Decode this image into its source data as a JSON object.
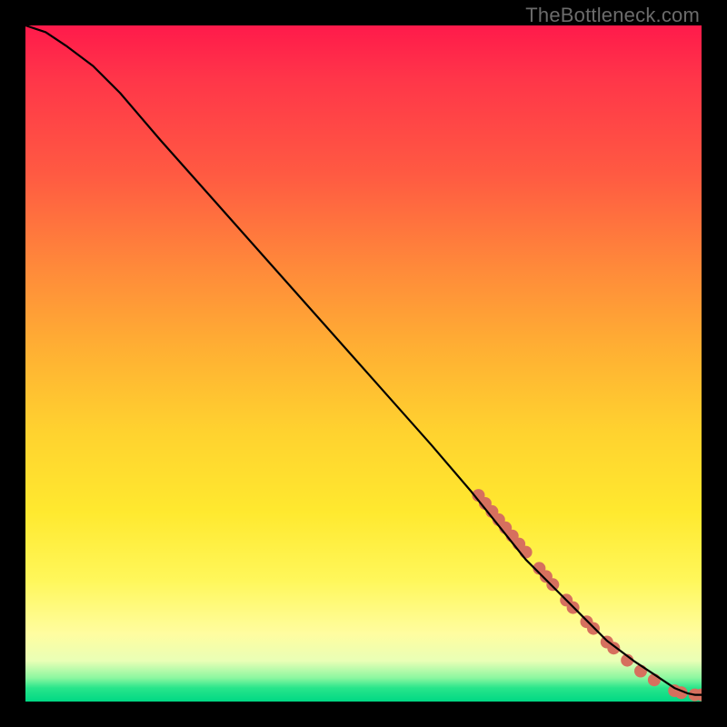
{
  "watermark": {
    "text": "TheBottleneck.com"
  },
  "chart_data": {
    "type": "line",
    "title": "",
    "xlabel": "",
    "ylabel": "",
    "xlim": [
      0,
      100
    ],
    "ylim": [
      0,
      100
    ],
    "grid": false,
    "legend": false,
    "background_gradient": "red-yellow-green-vertical",
    "series": [
      {
        "name": "curve",
        "color": "#000000",
        "x": [
          0,
          3,
          6,
          10,
          14,
          20,
          28,
          36,
          44,
          52,
          60,
          66,
          70,
          74,
          78,
          82,
          86,
          90,
          93,
          96,
          98,
          99,
          100
        ],
        "y": [
          100,
          99,
          97,
          94,
          90,
          83,
          74,
          65,
          56,
          47,
          38,
          31,
          26,
          21,
          17,
          13,
          9,
          6,
          4,
          2,
          1.2,
          1,
          1
        ]
      }
    ],
    "markers": {
      "name": "highlight-segments",
      "color": "#d6705e",
      "radius_px": 7,
      "points_xy": [
        [
          67,
          30.5
        ],
        [
          68,
          29.3
        ],
        [
          69,
          28.1
        ],
        [
          70,
          26.9
        ],
        [
          71,
          25.7
        ],
        [
          72,
          24.5
        ],
        [
          73,
          23.3
        ],
        [
          74,
          22.1
        ],
        [
          76,
          19.7
        ],
        [
          77,
          18.5
        ],
        [
          78,
          17.3
        ],
        [
          80,
          15.0
        ],
        [
          81,
          13.9
        ],
        [
          83,
          11.8
        ],
        [
          84,
          10.8
        ],
        [
          86,
          8.8
        ],
        [
          87,
          7.9
        ],
        [
          89,
          6.1
        ],
        [
          91,
          4.5
        ],
        [
          93,
          3.2
        ],
        [
          96,
          1.6
        ],
        [
          97,
          1.3
        ],
        [
          99,
          1.0
        ],
        [
          100,
          1.0
        ]
      ]
    }
  }
}
